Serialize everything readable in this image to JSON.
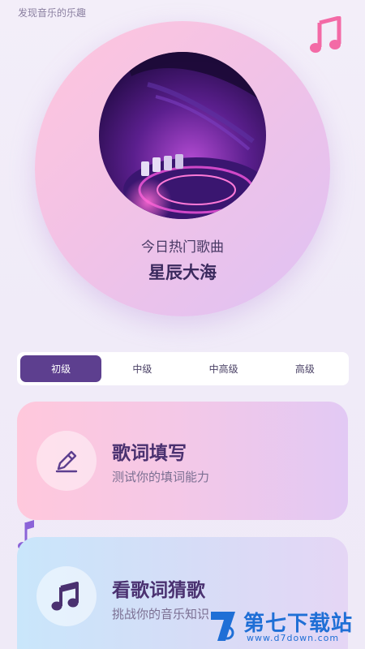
{
  "header": {
    "tagline": "发现音乐的乐趣"
  },
  "hero": {
    "subtitle": "今日热门歌曲",
    "song_title": "星辰大海"
  },
  "levels": {
    "items": [
      "初级",
      "中级",
      "中高级",
      "高级"
    ],
    "selected": "初级"
  },
  "cards": [
    {
      "title": "歌词填写",
      "desc": "测试你的填词能力",
      "icon": "pencil-icon"
    },
    {
      "title": "看歌词猜歌",
      "desc": "挑战你的音乐知识",
      "icon": "music-note-icon"
    }
  ],
  "watermark": {
    "brand": "第七下载站",
    "url": "www.d7down.com"
  },
  "colors": {
    "accent": "#5d3f8f",
    "note_pink": "#f36aa6",
    "note_purple": "#8b63d8",
    "watermark_blue": "#1f6fd6"
  }
}
